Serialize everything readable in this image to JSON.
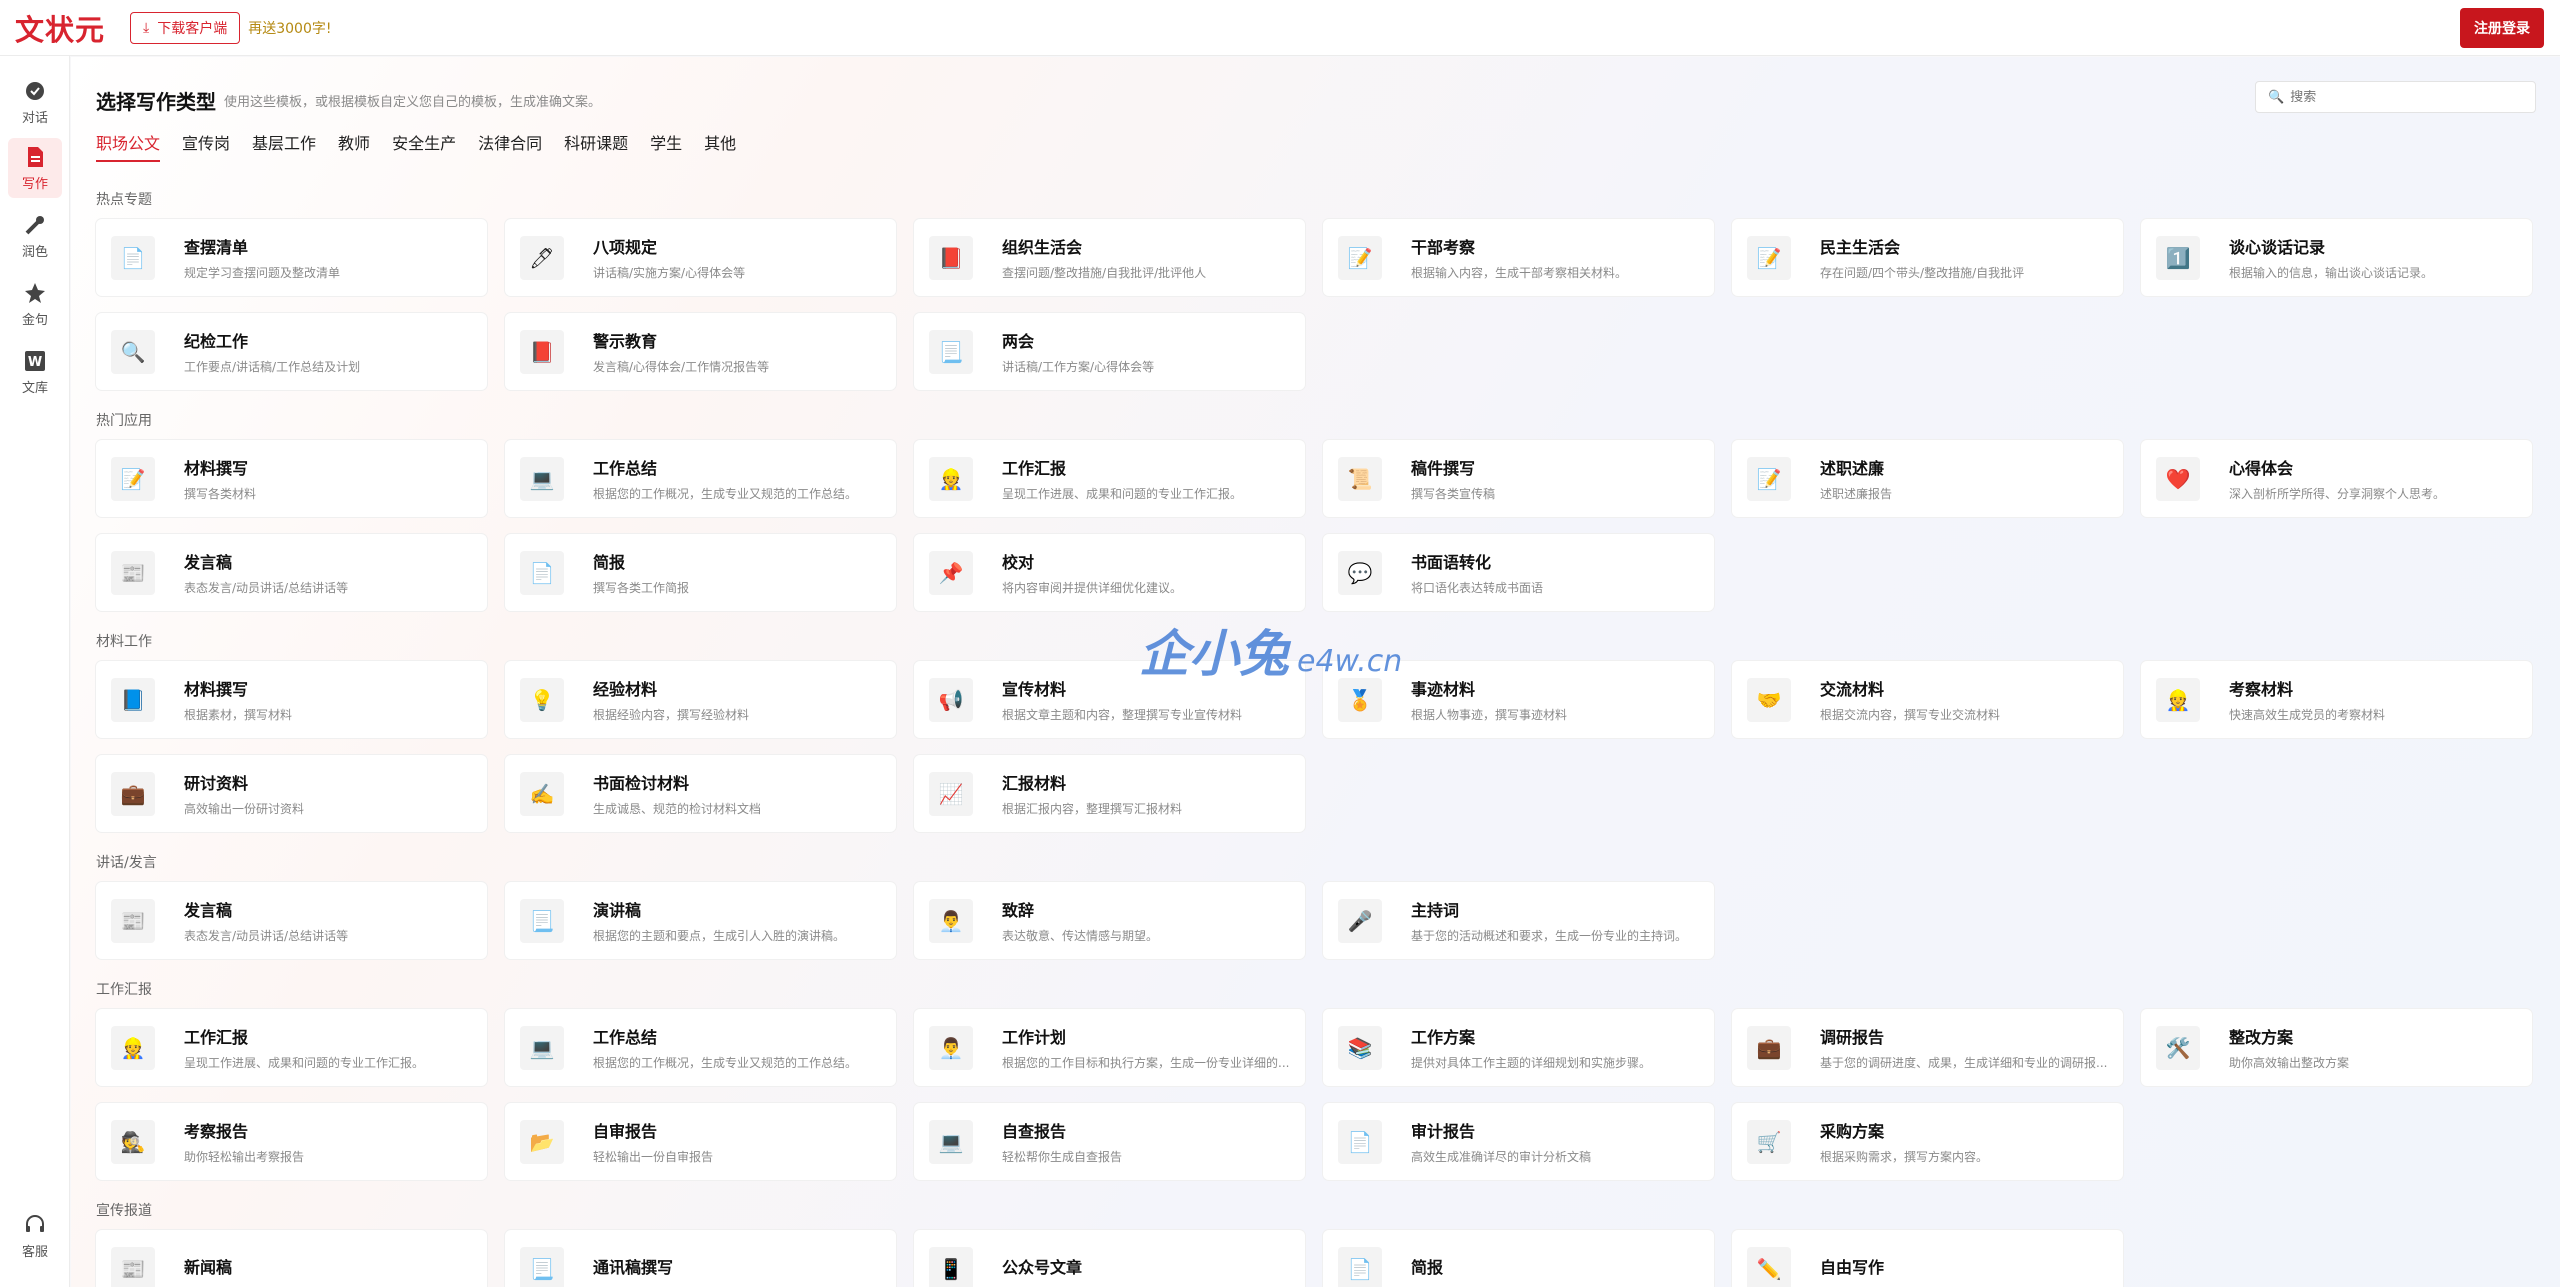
{
  "header": {
    "logo": "文状元",
    "download_label": "下载客户端",
    "bonus_text": "再送3000字!",
    "register_label": "注册登录"
  },
  "sidebar": {
    "items": [
      {
        "label": "对话",
        "icon": "chat-icon"
      },
      {
        "label": "写作",
        "icon": "write-icon"
      },
      {
        "label": "润色",
        "icon": "polish-icon"
      },
      {
        "label": "金句",
        "icon": "quote-icon"
      },
      {
        "label": "文库",
        "icon": "library-icon"
      }
    ],
    "service_label": "客服"
  },
  "main": {
    "title": "选择写作类型",
    "subtitle": "使用这些模板，或根据模板自定义您自己的模板，生成准确文案。",
    "search_placeholder": "搜索",
    "tabs": [
      "职场公文",
      "宣传岗",
      "基层工作",
      "教师",
      "安全生产",
      "法律合同",
      "科研课题",
      "学生",
      "其他"
    ],
    "sections": [
      {
        "label": "热点专题",
        "cards": [
          {
            "title": "查摆清单",
            "desc": "规定学习查摆问题及整改清单",
            "icon": "📄"
          },
          {
            "title": "八项规定",
            "desc": "讲话稿/实施方案/心得体会等",
            "icon": "🖊"
          },
          {
            "title": "组织生活会",
            "desc": "查摆问题/整改措施/自我批评/批评他人",
            "icon": "📕"
          },
          {
            "title": "干部考察",
            "desc": "根据输入内容，生成干部考察相关材料。",
            "icon": "📝"
          },
          {
            "title": "民主生活会",
            "desc": "存在问题/四个带头/整改措施/自我批评",
            "icon": "📝"
          },
          {
            "title": "谈心谈话记录",
            "desc": "根据输入的信息，输出谈心谈话记录。",
            "icon": "1️⃣"
          },
          {
            "title": "纪检工作",
            "desc": "工作要点/讲话稿/工作总结及计划",
            "icon": "🔍"
          },
          {
            "title": "警示教育",
            "desc": "发言稿/心得体会/工作情况报告等",
            "icon": "📕"
          },
          {
            "title": "两会",
            "desc": "讲话稿/工作方案/心得体会等",
            "icon": "📃"
          }
        ]
      },
      {
        "label": "热门应用",
        "cards": [
          {
            "title": "材料撰写",
            "desc": "撰写各类材料",
            "icon": "📝"
          },
          {
            "title": "工作总结",
            "desc": "根据您的工作概况，生成专业又规范的工作总结。",
            "icon": "💻"
          },
          {
            "title": "工作汇报",
            "desc": "呈现工作进展、成果和问题的专业工作汇报。",
            "icon": "👷"
          },
          {
            "title": "稿件撰写",
            "desc": "撰写各类宣传稿",
            "icon": "📜"
          },
          {
            "title": "述职述廉",
            "desc": "述职述廉报告",
            "icon": "📝"
          },
          {
            "title": "心得体会",
            "desc": "深入剖析所学所得、分享洞察个人思考。",
            "icon": "❤️"
          },
          {
            "title": "发言稿",
            "desc": "表态发言/动员讲话/总结讲话等",
            "icon": "📰"
          },
          {
            "title": "简报",
            "desc": "撰写各类工作简报",
            "icon": "📄"
          },
          {
            "title": "校对",
            "desc": "将内容审阅并提供详细优化建议。",
            "icon": "📌"
          },
          {
            "title": "书面语转化",
            "desc": "将口语化表达转成书面语",
            "icon": "💬"
          }
        ]
      },
      {
        "label": "材料工作",
        "cards": [
          {
            "title": "材料撰写",
            "desc": "根据素材，撰写材料",
            "icon": "📘"
          },
          {
            "title": "经验材料",
            "desc": "根据经验内容，撰写经验材料",
            "icon": "💡"
          },
          {
            "title": "宣传材料",
            "desc": "根据文章主题和内容，整理撰写专业宣传材料",
            "icon": "📢"
          },
          {
            "title": "事迹材料",
            "desc": "根据人物事迹，撰写事迹材料",
            "icon": "🏅"
          },
          {
            "title": "交流材料",
            "desc": "根据交流内容，撰写专业交流材料",
            "icon": "🤝"
          },
          {
            "title": "考察材料",
            "desc": "快速高效生成党员的考察材料",
            "icon": "👷"
          },
          {
            "title": "研讨资料",
            "desc": "高效输出一份研讨资料",
            "icon": "💼"
          },
          {
            "title": "书面检讨材料",
            "desc": "生成诚恳、规范的检讨材料文档",
            "icon": "✍️"
          },
          {
            "title": "汇报材料",
            "desc": "根据汇报内容，整理撰写汇报材料",
            "icon": "📈"
          }
        ]
      },
      {
        "label": "讲话/发言",
        "cards": [
          {
            "title": "发言稿",
            "desc": "表态发言/动员讲话/总结讲话等",
            "icon": "📰"
          },
          {
            "title": "演讲稿",
            "desc": "根据您的主题和要点，生成引人入胜的演讲稿。",
            "icon": "📃"
          },
          {
            "title": "致辞",
            "desc": "表达敬意、传达情感与期望。",
            "icon": "👨‍💼"
          },
          {
            "title": "主持词",
            "desc": "基于您的活动概述和要求，生成一份专业的主持词。",
            "icon": "🎤"
          }
        ]
      },
      {
        "label": "工作汇报",
        "cards": [
          {
            "title": "工作汇报",
            "desc": "呈现工作进展、成果和问题的专业工作汇报。",
            "icon": "👷"
          },
          {
            "title": "工作总结",
            "desc": "根据您的工作概况，生成专业又规范的工作总结。",
            "icon": "💻"
          },
          {
            "title": "工作计划",
            "desc": "根据您的工作目标和执行方案，生成一份专业详细的...",
            "icon": "👨‍💼"
          },
          {
            "title": "工作方案",
            "desc": "提供对具体工作主题的详细规划和实施步骤。",
            "icon": "📚"
          },
          {
            "title": "调研报告",
            "desc": "基于您的调研进度、成果，生成详细和专业的调研报...",
            "icon": "💼"
          },
          {
            "title": "整改方案",
            "desc": "助你高效输出整改方案",
            "icon": "🛠️"
          },
          {
            "title": "考察报告",
            "desc": "助你轻松输出考察报告",
            "icon": "🕵️"
          },
          {
            "title": "自审报告",
            "desc": "轻松输出一份自审报告",
            "icon": "📂"
          },
          {
            "title": "自查报告",
            "desc": "轻松帮你生成自查报告",
            "icon": "💻"
          },
          {
            "title": "审计报告",
            "desc": "高效生成准确详尽的审计分析文稿",
            "icon": "📄"
          },
          {
            "title": "采购方案",
            "desc": "根据采购需求，撰写方案内容。",
            "icon": "🛒"
          }
        ]
      },
      {
        "label": "宣传报道",
        "cards": [
          {
            "title": "新闻稿",
            "desc": "",
            "icon": "📰"
          },
          {
            "title": "通讯稿撰写",
            "desc": "",
            "icon": "📃"
          },
          {
            "title": "公众号文章",
            "desc": "",
            "icon": "📱"
          },
          {
            "title": "简报",
            "desc": "",
            "icon": "📄"
          },
          {
            "title": "自由写作",
            "desc": "",
            "icon": "✏️"
          }
        ]
      }
    ]
  },
  "watermark": {
    "text1": "企小兔",
    "text2": "e4w.cn"
  }
}
